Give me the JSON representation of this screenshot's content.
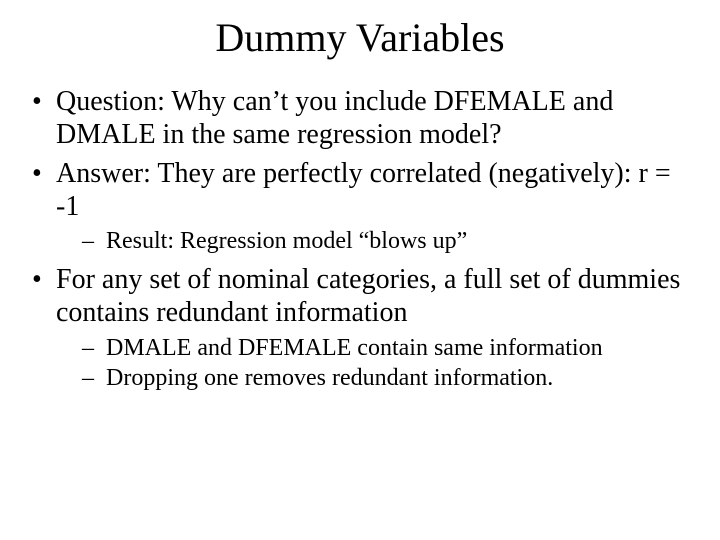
{
  "title": "Dummy Variables",
  "bullets": {
    "b1": "Question:  Why can’t you include DFEMALE and DMALE in the same regression model?",
    "b2": "Answer:  They are perfectly correlated (negatively):  r = -1",
    "b2_sub1": "Result:  Regression model “blows up”",
    "b3": "For any set of nominal categories, a full set of dummies contains redundant information",
    "b3_sub1": "DMALE and DFEMALE contain same information",
    "b3_sub2": "Dropping one removes redundant information."
  }
}
